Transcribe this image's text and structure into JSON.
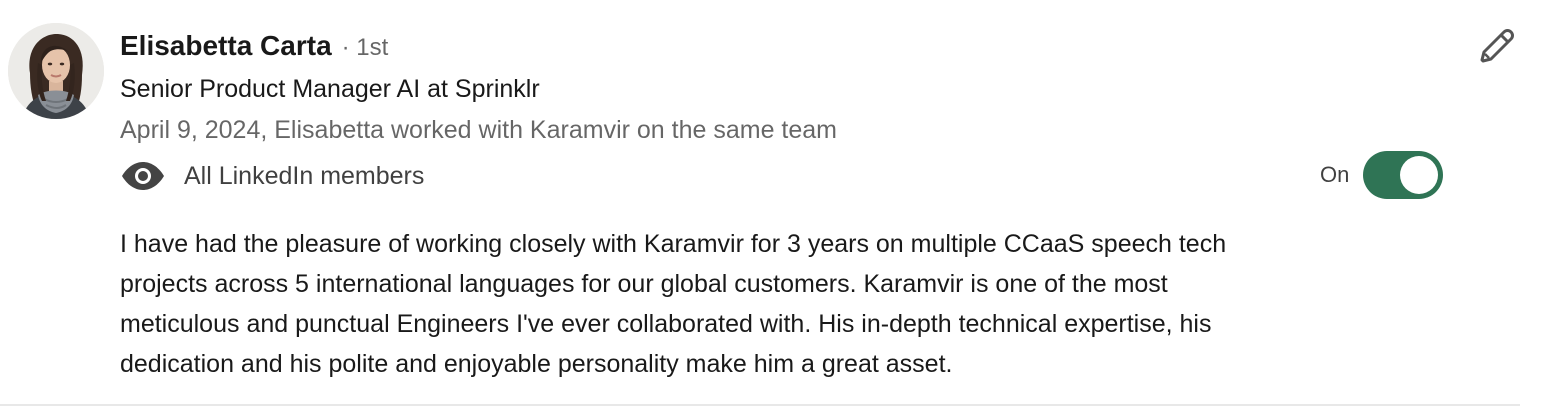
{
  "recommendation": {
    "recommender_name": "Elisabetta Carta",
    "connection_degree": "· 1st",
    "headline": "Senior Product Manager AI at Sprinklr",
    "meta": "April 9, 2024, Elisabetta worked with Karamvir on the same team",
    "visibility": {
      "icon": "eye-icon",
      "label": "All LinkedIn members"
    },
    "toggle": {
      "label": "On",
      "state": "on",
      "color": "#2f7455"
    },
    "edit_icon": "pencil-icon",
    "text_lines": [
      "I have had the pleasure of working closely with Karamvir for 3 years on multiple CCaaS speech tech",
      "projects across 5 international languages for our global customers. Karamvir is one of the most",
      "meticulous and punctual Engineers I've ever collaborated with. His in-depth technical expertise, his",
      "dedication and his polite and enjoyable personality make him a great asset."
    ]
  }
}
